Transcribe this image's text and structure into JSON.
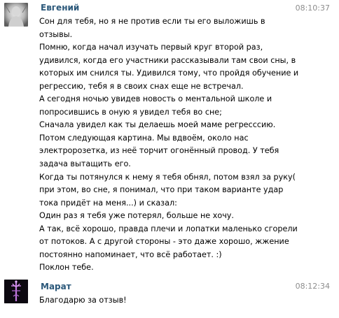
{
  "messages": [
    {
      "author": "Евгений",
      "time": "08:10:37",
      "avatar_icon": "person-photo-avatar",
      "lines": [
        "Сон для тебя, но я не против если ты его выложишь в",
        "отзывы.",
        "Помню, когда начал изучать первый круг второй раз,",
        "удивился, когда его участники рассказывали там свои сны, в",
        "которых им снился ты. Удивился тому, что пройдя обучение и",
        "регрессию, тебя я в своих снах еще не встречал.",
        "А сегодня ночью увидев новость о ментальной школе и",
        "попросившись в оную я увидел тебя во сне;",
        "Сначала увидел как ты делаешь моей маме регресссию.",
        "Потом следующая картина. Мы вдвоём, около нас",
        "электророзетка, из неё торчит огонённый провод. У тебя",
        "задача вытащить его.",
        "Когда ты потянулся к нему я тебя обнял, потом взял за руку(",
        "при этом, во сне, я понимал, что при таком варианте удар",
        "тока придёт на меня...) и сказал:",
        "Один раз я тебя уже потерял, больше не хочу.",
        "А так, всё хорошо, правда плечи и лопатки маленько сгорели",
        "от потоков. А с другой стороны - это даже хорошо, жжение",
        "постоянно напоминает, что всё работает. :)",
        "Поклон тебе."
      ]
    },
    {
      "author": "Марат",
      "time": "08:12:34",
      "avatar_icon": "purple-symbol-avatar",
      "lines": [
        "Благодарю за отзыв!"
      ]
    }
  ],
  "colors": {
    "author": "#2b587a",
    "time": "#8d8d8d",
    "text": "#000000"
  }
}
